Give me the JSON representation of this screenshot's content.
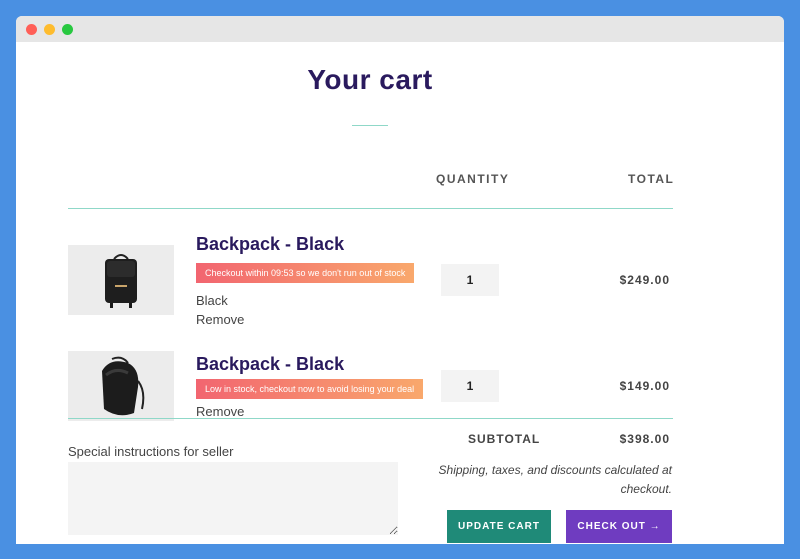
{
  "page": {
    "title": "Your cart",
    "title_color": "#2a1a5e",
    "accent_color": "#8fd8c8"
  },
  "columns": {
    "quantity": "QUANTITY",
    "total": "TOTAL"
  },
  "items": [
    {
      "name": "Backpack - Black",
      "urgency": "Checkout within 09:53 so we don't run out of stock",
      "variant": "Black",
      "remove_label": "Remove",
      "quantity": "1",
      "price": "$249.00"
    },
    {
      "name": "Backpack - Black",
      "urgency": "Low in stock, checkout now to avoid losing your deal",
      "remove_label": "Remove",
      "quantity": "1",
      "price": "$149.00"
    }
  ],
  "notes": {
    "label": "Special instructions for seller",
    "value": ""
  },
  "summary": {
    "subtotal_label": "SUBTOTAL",
    "subtotal_value": "$398.00",
    "shipping_note": "Shipping, taxes, and discounts calculated at checkout."
  },
  "buttons": {
    "update_label": "UPDATE CART",
    "checkout_label": "CHECK OUT →",
    "update_color": "#1f8a78",
    "checkout_color": "#6f3cc0"
  }
}
